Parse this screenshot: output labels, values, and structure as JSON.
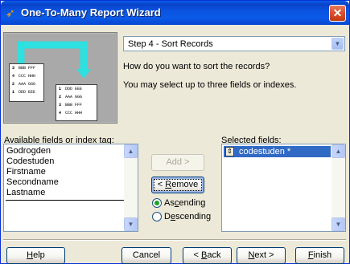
{
  "window": {
    "title": "One-To-Many Report Wizard",
    "close_glyph": "✕"
  },
  "step": {
    "selected": "Step 4 - Sort Records"
  },
  "instructions": {
    "question": "How do you want to sort the records?",
    "hint": "You may select up to three fields or indexes."
  },
  "available": {
    "label_prefix": "A",
    "label_rest": "vailable fields or index tag:",
    "items": [
      "Godrogden",
      "Codestuden",
      "Firstname",
      "Secondname",
      "Lastname"
    ]
  },
  "selected": {
    "label_prefix": "S",
    "label_rest": "elected fields:",
    "items": [
      "codestuden *"
    ],
    "mover_glyph": "⇕"
  },
  "middle": {
    "add_label": "Add >",
    "remove_prefix": "< ",
    "remove_key": "R",
    "remove_rest": "emove",
    "ascending_pre": "As",
    "ascending_key": "c",
    "ascending_rest": "ending",
    "descending_pre": "D",
    "descending_key": "e",
    "descending_rest": "scending",
    "sort_order": "ascending"
  },
  "picture": {
    "left_doc": [
      {
        "num": "3",
        "text": "BBB FFF"
      },
      {
        "num": "4",
        "text": "CCC HHH"
      },
      {
        "num": "2",
        "text": "AAA GGG"
      },
      {
        "num": "1",
        "text": "DDD EEE"
      }
    ],
    "right_doc": [
      {
        "num": "1",
        "text": "DDD EEE"
      },
      {
        "num": "2",
        "text": "AAA GGG"
      },
      {
        "num": "3",
        "text": "BBB FFF"
      },
      {
        "num": "4",
        "text": "CCC HHH"
      }
    ]
  },
  "footer": {
    "help_key": "H",
    "help_rest": "elp",
    "cancel": "Cancel",
    "back_prefix": "< ",
    "back_key": "B",
    "back_rest": "ack",
    "next_key": "N",
    "next_rest": "ext >",
    "finish_key": "F",
    "finish_rest": "inish"
  },
  "colors": {
    "titlebar": "#0a53e0",
    "accent_cyan": "#2fe0e0",
    "selection": "#316ac5"
  }
}
